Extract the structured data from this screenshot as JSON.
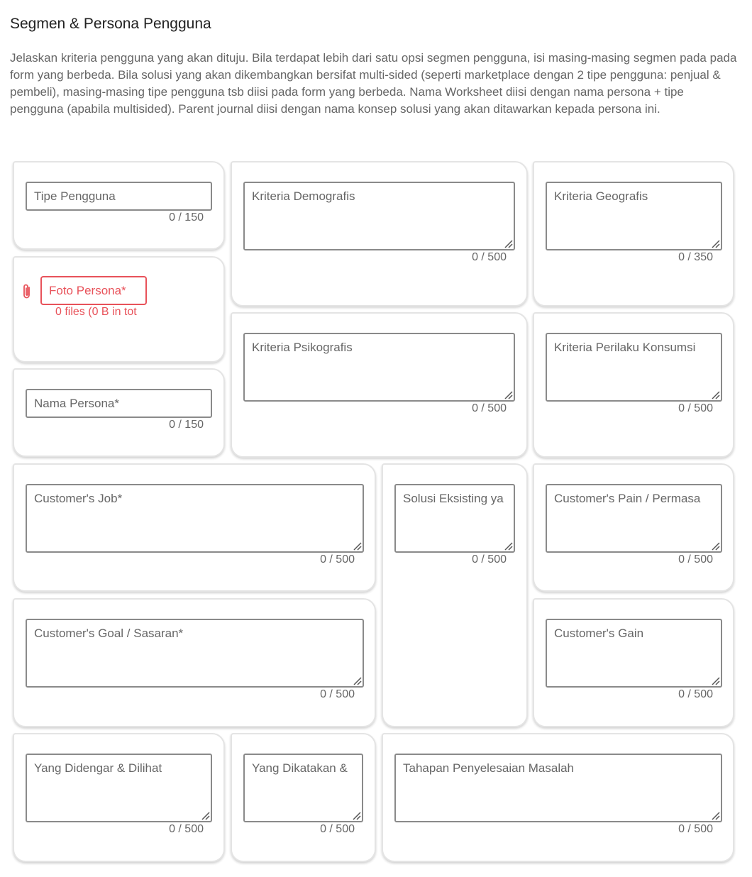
{
  "page": {
    "title": "Segmen & Persona Pengguna",
    "description": "Jelaskan kriteria pengguna yang akan dituju. Bila terdapat lebih dari satu opsi segmen pengguna, isi masing-masing segmen pada pada form yang berbeda. Bila solusi yang akan dikembangkan bersifat multi-sided (seperti marketplace dengan 2 tipe pengguna: penjual & pembeli), masing-masing tipe pengguna tsb diisi pada form yang berbeda. Nama Worksheet diisi dengan nama persona + tipe pengguna (apabila multisided). Parent journal diisi dengan nama konsep solusi yang akan ditawarkan kepada persona ini."
  },
  "fields": {
    "tipe_pengguna": {
      "placeholder": "Tipe Pengguna",
      "counter": "0 / 150"
    },
    "foto_persona": {
      "placeholder": "Foto Persona*",
      "file_info": "0 files (0 B in tot",
      "icon": "paperclip-icon",
      "color": "#e8525a"
    },
    "nama_persona": {
      "placeholder": "Nama Persona*",
      "counter": "0 / 150"
    },
    "kriteria_demografis": {
      "placeholder": "Kriteria Demografis",
      "counter": "0 / 500"
    },
    "kriteria_geografis": {
      "placeholder": "Kriteria Geografis",
      "counter": "0 / 350"
    },
    "kriteria_psikografis": {
      "placeholder": "Kriteria Psikografis",
      "counter": "0 / 500"
    },
    "kriteria_perilaku": {
      "placeholder": "Kriteria Perilaku Konsumsi",
      "counter": "0 / 500"
    },
    "customers_job": {
      "placeholder": "Customer's Job*",
      "counter": "0 / 500"
    },
    "solusi_eksisting": {
      "placeholder": "Solusi Eksisting ya",
      "counter": "0 / 500"
    },
    "customers_pain": {
      "placeholder": "Customer's Pain / Permasa",
      "counter": "0 / 500"
    },
    "customers_goal": {
      "placeholder": "Customer's Goal / Sasaran*",
      "counter": "0 / 500"
    },
    "customers_gain": {
      "placeholder": "Customer's Gain",
      "counter": "0 / 500"
    },
    "yang_didengar": {
      "placeholder": "Yang Didengar & Dilihat",
      "counter": "0 / 500"
    },
    "yang_dikatakan": {
      "placeholder": "Yang Dikatakan &",
      "counter": "0 / 500"
    },
    "tahapan_penyelesaian": {
      "placeholder": "Tahapan Penyelesaian Masalah",
      "counter": "0 / 500"
    }
  },
  "colors": {
    "error": "#e8525a",
    "border": "#8a8a8a",
    "card_border": "#e4e4e4"
  }
}
